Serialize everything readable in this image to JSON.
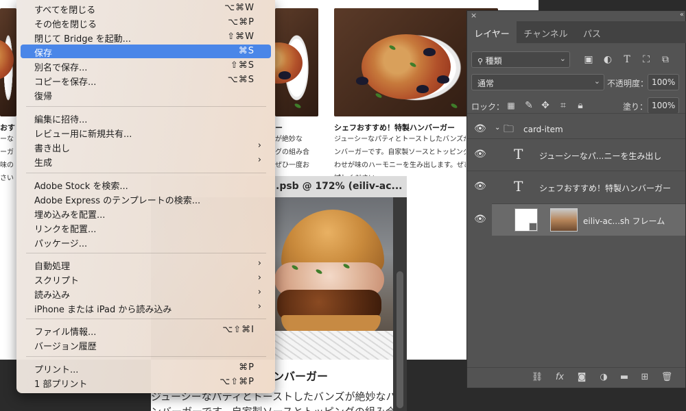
{
  "file_menu": {
    "items": [
      {
        "label": "すべてを閉じる",
        "shortcut": "⌥⌘W"
      },
      {
        "label": "その他を閉じる",
        "shortcut": "⌥⌘P"
      },
      {
        "label": "閉じて Bridge を起動...",
        "shortcut": "⇧⌘W"
      },
      {
        "label": "保存",
        "shortcut": "⌘S",
        "selected": true
      },
      {
        "label": "別名で保存...",
        "shortcut": "⇧⌘S"
      },
      {
        "label": "コピーを保存...",
        "shortcut": "⌥⌘S"
      },
      {
        "label": "復帰",
        "shortcut": ""
      },
      {
        "label": "編集に招待...",
        "shortcut": ""
      },
      {
        "label": "レビュー用に新規共有...",
        "shortcut": ""
      },
      {
        "label": "書き出し",
        "submenu": true
      },
      {
        "label": "生成",
        "submenu": true
      },
      {
        "label": "Adobe Stock を検索...",
        "shortcut": ""
      },
      {
        "label": "Adobe Express のテンプレートの検索...",
        "shortcut": ""
      },
      {
        "label": "埋め込みを配置...",
        "shortcut": ""
      },
      {
        "label": "リンクを配置...",
        "shortcut": ""
      },
      {
        "label": "パッケージ...",
        "shortcut": ""
      },
      {
        "label": "自動処理",
        "submenu": true
      },
      {
        "label": "スクリプト",
        "submenu": true
      },
      {
        "label": "読み込み",
        "submenu": true
      },
      {
        "label": "iPhone または iPad から読み込み",
        "submenu": true
      },
      {
        "label": "ファイル情報...",
        "shortcut": "⌥⇧⌘I"
      },
      {
        "label": "バージョン履歴",
        "shortcut": ""
      },
      {
        "label": "プリント...",
        "shortcut": "⌘P"
      },
      {
        "label": "1 部プリント",
        "shortcut": "⌥⇧⌘P"
      }
    ],
    "submenu_arrow": "›"
  },
  "canvas": {
    "card_left": {
      "title": "おす",
      "lines": [
        "ーな",
        "ーガ",
        "味の",
        "さい"
      ]
    },
    "card_mid": {
      "title": "ー",
      "lines": [
        "が絶妙な",
        "グの組み合",
        "ぜひ一度お",
        ""
      ]
    },
    "card_right": {
      "title": "シェフおすすめ！特製ハンバーガー",
      "lines": [
        "ジューシーなパティとトーストしたバンズが絶妙なハ",
        "ンバーガーです。自家製ソースとトッピングの組み合",
        "わせが味のハーモニーを生み出します。ぜひ一度お",
        "試しください"
      ]
    }
  },
  "document_window": {
    "title": ".psb @ 172% (eiliv-ac...",
    "heading": "ンバーガー",
    "line1": "ジューシーなパティとトーストしたバンズが絶妙なハ",
    "line2": "ンバーガーです。自家製ソースとトッピングの組み合"
  },
  "layers_panel": {
    "close": "×",
    "collapse": "«",
    "tabs": [
      "レイヤー",
      "チャンネル",
      "パス"
    ],
    "active_tab": "レイヤー",
    "filter_kind": "種類",
    "blend_mode": "通常",
    "opacity_label": "不透明度：",
    "opacity_value": "100%",
    "lock_label": "ロック：",
    "fill_label": "塗り：",
    "fill_value": "100%",
    "layers": [
      {
        "name": "card-item",
        "type": "group",
        "expanded": true
      },
      {
        "name": "ジューシーなパ...ニーを生み出し",
        "type": "text"
      },
      {
        "name": "シェフおすすめ！特製ハンバーガー",
        "type": "text"
      },
      {
        "name": "eiliv-ac...sh フレーム",
        "type": "frame",
        "selected": true
      }
    ],
    "footer_icons": [
      "link-icon",
      "fx-icon",
      "mask-icon",
      "adjustment-icon",
      "folder-icon",
      "new-layer-icon",
      "trash-icon"
    ],
    "fx_label": "fx"
  },
  "colors": {
    "menu_highlight": "#4a86e8",
    "panel_bg": "#535353",
    "selected_layer": "#6a6a6a"
  }
}
